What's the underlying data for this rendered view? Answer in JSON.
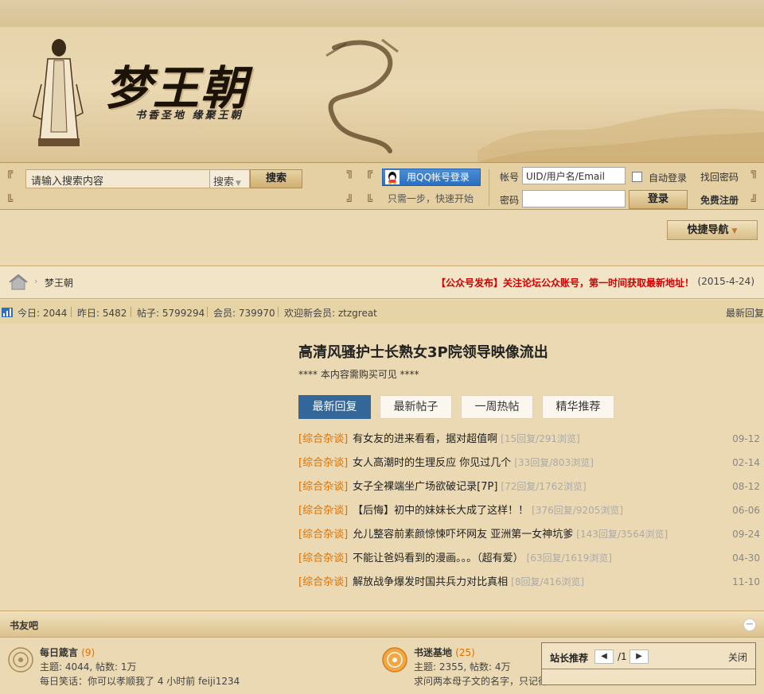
{
  "banner": {
    "logo_text": "梦王朝",
    "slogan": "书香圣地 缘聚王朝"
  },
  "search": {
    "placeholder": "请输入搜索内容",
    "type_label": "搜索",
    "button_label": "搜索"
  },
  "qq_login": {
    "button_label": "用QQ帐号登录",
    "note": "只需一步，快速开始"
  },
  "login": {
    "account_label": "帐号",
    "account_placeholder": "UID/用户名/Email",
    "password_label": "密码",
    "auto_login_label": "自动登录",
    "login_button": "登录",
    "forgot_link": "找回密码",
    "register_link": "免费注册"
  },
  "quick_nav": {
    "label": "快捷导航"
  },
  "breadcrumb": {
    "site": "梦王朝",
    "notice": "【公众号发布】关注论坛公众账号，第一时间获取最新地址！",
    "notice_date": "(2015-4-24)"
  },
  "stats": {
    "today": "今日: 2044",
    "yesterday": "昨日: 5482",
    "posts": "帖子: 5799294",
    "members": "会员: 739970",
    "welcome": "欢迎新会员: ztzgreat",
    "latest_replies": "最新回复"
  },
  "hot": {
    "title": "高清风骚护士长熟女3P院领导映像流出",
    "subtitle": "**** 本内容需购买可见 ****",
    "tabs": [
      "最新回复",
      "最新帖子",
      "一周热帖",
      "精华推荐"
    ],
    "threads": [
      {
        "category": "[综合杂谈]",
        "title": "有女友的进来看看，据对超值啊",
        "meta": "[15回复/291浏览]",
        "date": "09-12"
      },
      {
        "category": "[综合杂谈]",
        "title": "女人高潮时的生理反应 你见过几个",
        "meta": "[33回复/803浏览]",
        "date": "02-14"
      },
      {
        "category": "[综合杂谈]",
        "title": "女子全裸端坐广场欲破记录[7P]",
        "meta": "[72回复/1762浏览]",
        "date": "08-12"
      },
      {
        "category": "[综合杂谈]",
        "title": "【后悔】初中的妹妹长大成了这样！！",
        "meta": "[376回复/9205浏览]",
        "date": "06-06"
      },
      {
        "category": "[综合杂谈]",
        "title": "允儿整容前素颜惊悚吓坏网友 亚洲第一女神坑爹",
        "meta": "[143回复/3564浏览]",
        "date": "09-24"
      },
      {
        "category": "[综合杂谈]",
        "title": "不能让爸妈看到的漫画。。。（超有爱）",
        "meta": "[63回复/1619浏览]",
        "date": "04-30"
      },
      {
        "category": "[综合杂谈]",
        "title": "解放战争爆发时国共兵力对比真相",
        "meta": "[8回复/416浏览]",
        "date": "11-10"
      }
    ]
  },
  "section": {
    "name": "书友吧",
    "collapse": "−",
    "forums": [
      {
        "name": "每日箴言",
        "count": "(9)",
        "stats": "主题: 4044, 帖数: 1万",
        "last": "每日笑话：你可以孝顺我了 4 小时前 feiji1234"
      },
      {
        "name": "书迷基地",
        "count": "(25)",
        "stats": "主题: 2355, 帖数: 4万",
        "last": "求问两本母子文的名字，只记得"
      }
    ]
  },
  "recommend": {
    "title": "站长推荐",
    "prev": "◀",
    "next": "▶",
    "page": "/1",
    "close": "关闭"
  },
  "colors": {
    "accent_tab": "#336699",
    "category": "#e07000",
    "notice": "#d40000"
  }
}
